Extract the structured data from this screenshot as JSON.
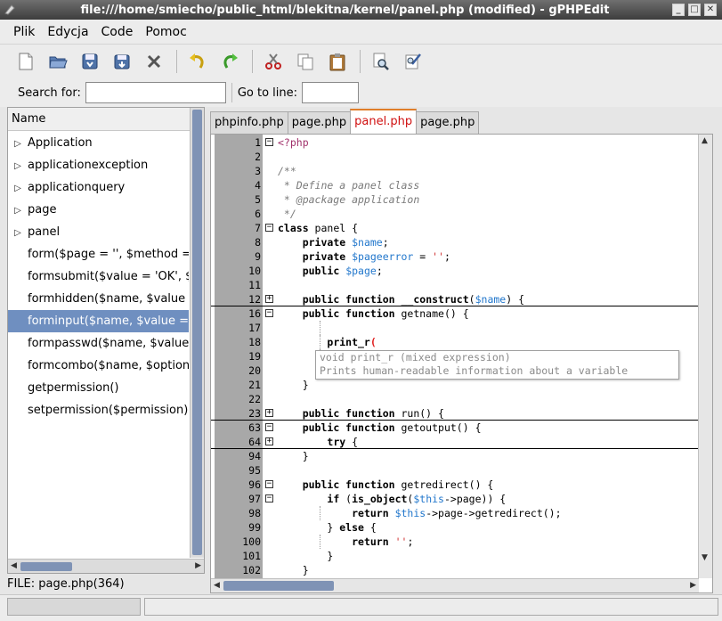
{
  "window": {
    "title": "file:///home/smiecho/public_html/blekitna/kernel/panel.php (modified) - gPHPEdit",
    "controls": [
      "minimize",
      "maximize",
      "close"
    ]
  },
  "menubar": {
    "items": [
      "Plik",
      "Edycja",
      "Code",
      "Pomoc"
    ]
  },
  "toolbar": {
    "buttons": [
      "new-file-icon",
      "open-folder-icon",
      "save-icon",
      "save-as-icon",
      "close-icon",
      "undo-icon",
      "redo-icon",
      "cut-icon",
      "copy-icon",
      "paste-icon",
      "find-icon",
      "replace-icon"
    ]
  },
  "search": {
    "search_label": "Search for:",
    "search_value": "",
    "goto_label": "Go to line:",
    "goto_value": ""
  },
  "sidebar": {
    "header": "Name",
    "items": [
      {
        "label": "Application",
        "expandable": true
      },
      {
        "label": "applicationexception",
        "expandable": true
      },
      {
        "label": "applicationquery",
        "expandable": true
      },
      {
        "label": "page",
        "expandable": true
      },
      {
        "label": "panel",
        "expandable": true
      },
      {
        "label": "form($page = '', $method = 'POST')",
        "expandable": false
      },
      {
        "label": "formsubmit($value = 'OK', $name)",
        "expandable": false
      },
      {
        "label": "formhidden($name, $value = '')",
        "expandable": false
      },
      {
        "label": "forminput($name, $value = '')",
        "expandable": false,
        "selected": true
      },
      {
        "label": "formpasswd($name, $value = '')",
        "expandable": false
      },
      {
        "label": "formcombo($name, $options)",
        "expandable": false
      },
      {
        "label": "getpermission()",
        "expandable": false
      },
      {
        "label": "setpermission($permission)",
        "expandable": false
      }
    ],
    "file_info": "FILE: page.php(364)"
  },
  "tabs": [
    {
      "label": "phpinfo.php",
      "active": false
    },
    {
      "label": "page.php",
      "active": false
    },
    {
      "label": "panel.php",
      "active": true
    },
    {
      "label": "page.php",
      "active": false
    }
  ],
  "editor": {
    "lines": [
      {
        "num": "1",
        "fold": "-",
        "html": "<span class='php'>&lt;?php</span>"
      },
      {
        "num": "2",
        "html": ""
      },
      {
        "num": "3",
        "html": "<span class='cm'>/**</span>"
      },
      {
        "num": "4",
        "html": "<span class='cm'> * Define a panel class</span>"
      },
      {
        "num": "5",
        "html": "<span class='cm'> * @package application</span>"
      },
      {
        "num": "6",
        "html": "<span class='cm'> */</span>"
      },
      {
        "num": "7",
        "fold": "-",
        "html": "<span class='kw'>class</span> panel {"
      },
      {
        "num": "8",
        "html": "    <span class='kw'>private</span> <span class='var'>$name</span>;"
      },
      {
        "num": "9",
        "html": "    <span class='kw'>private</span> <span class='var'>$pageerror</span> = <span class='str'>''</span>;"
      },
      {
        "num": "10",
        "html": "    <span class='kw'>public</span> <span class='var'>$page</span>;"
      },
      {
        "num": "11",
        "html": ""
      },
      {
        "num": "12",
        "fold": "+",
        "foldline": true,
        "html": "    <span class='kw'>public function</span> __<span class='kw'>construct</span>(<span class='var'>$name</span>) {"
      },
      {
        "num": "16",
        "fold": "-",
        "html": "    <span class='kw'>public function</span> getname() {"
      },
      {
        "num": "17",
        "html": ""
      },
      {
        "num": "18",
        "html": "        <span class='kw'>print_r</span><span class='err'>(</span>"
      },
      {
        "num": "19",
        "html": ""
      },
      {
        "num": "20",
        "html": ""
      },
      {
        "num": "21",
        "html": "    }"
      },
      {
        "num": "22",
        "html": ""
      },
      {
        "num": "23",
        "fold": "+",
        "foldline": true,
        "html": "    <span class='kw'>public function</span> run() {"
      },
      {
        "num": "63",
        "fold": "-",
        "html": "    <span class='kw'>public function</span> getoutput() {"
      },
      {
        "num": "64",
        "fold": "+",
        "foldline": true,
        "html": "        <span class='kw'>try</span> {"
      },
      {
        "num": "94",
        "html": "    }"
      },
      {
        "num": "95",
        "html": ""
      },
      {
        "num": "96",
        "fold": "-",
        "html": "    <span class='kw'>public function</span> getredirect() {"
      },
      {
        "num": "97",
        "fold": "-",
        "html": "        <span class='kw'>if</span> (<span class='kw'>is_object</span>(<span class='var'>$this</span>-&gt;page)) {"
      },
      {
        "num": "98",
        "html": "            <span class='kw'>return</span> <span class='var'>$this</span>-&gt;page-&gt;getredirect();"
      },
      {
        "num": "99",
        "html": "        } <span class='kw'>else</span> {"
      },
      {
        "num": "100",
        "html": "            <span class='kw'>return</span> <span class='str'>''</span>;"
      },
      {
        "num": "101",
        "html": "        }"
      },
      {
        "num": "102",
        "html": "    }"
      }
    ],
    "calltip": {
      "signature": "void print_r (mixed expression)",
      "description": "Prints human-readable information about a variable"
    }
  },
  "statusbar": {
    "left": "",
    "right": ""
  }
}
